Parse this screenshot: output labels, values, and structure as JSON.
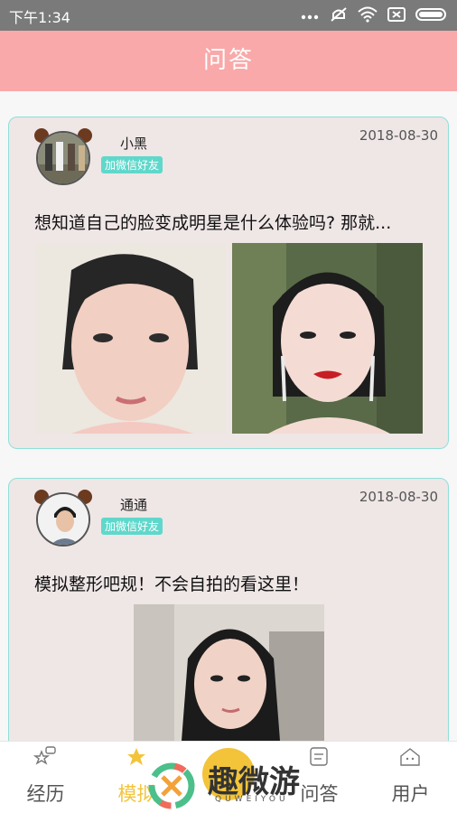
{
  "status_bar": {
    "time": "下午1:34"
  },
  "header": {
    "title": "问答"
  },
  "posts": [
    {
      "username": "小黑",
      "badge": "加微信好友",
      "date": "2018-08-30",
      "question": "想知道自己的脸变成明星是什么体验吗? 那就..."
    },
    {
      "username": "通通",
      "badge": "加微信好友",
      "date": "2018-08-30",
      "question": "模拟整形吧规！不会自拍的看这里！"
    }
  ],
  "nav": {
    "items": [
      {
        "label": "经历",
        "icon": "star-chat-icon"
      },
      {
        "label": "模拟",
        "icon": "star-icon",
        "active": true
      },
      {
        "label": "",
        "icon": "center-circle-icon"
      },
      {
        "label": "问答",
        "icon": "list-icon"
      },
      {
        "label": "用户",
        "icon": "home-icon"
      }
    ]
  },
  "watermark": {
    "brand": "趣微游",
    "sub": "QUWEIYOU"
  },
  "colors": {
    "header": "#f9a9a9",
    "accent": "#5fd8cb",
    "active": "#f3c43a"
  }
}
